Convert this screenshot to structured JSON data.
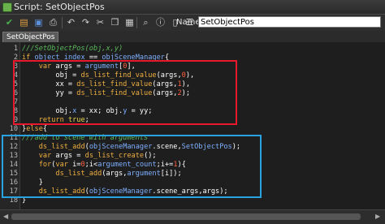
{
  "window": {
    "title": "Script: SetObjectPos"
  },
  "toolbar": {
    "name_label": "Name:",
    "name_value": "SetObjectPos",
    "buttons": [
      {
        "icon": "check-icon",
        "glyph": "✔",
        "color": "#4caf50"
      },
      {
        "icon": "open-icon",
        "glyph": "▤",
        "color": "#e0a040"
      },
      {
        "icon": "save-icon",
        "glyph": "▣",
        "color": "#5b8fd9"
      },
      {
        "icon": "print-icon",
        "glyph": "⎙",
        "color": "#cfcfcf"
      },
      {
        "icon": "undo-icon",
        "glyph": "↶",
        "color": "#cfcfcf"
      },
      {
        "icon": "redo-icon",
        "glyph": "↷",
        "color": "#cfcfcf"
      },
      {
        "icon": "cut-icon",
        "glyph": "✂",
        "color": "#cfcfcf"
      },
      {
        "icon": "copy-icon",
        "glyph": "❐",
        "color": "#cfcfcf"
      },
      {
        "icon": "paste-icon",
        "glyph": "▦",
        "color": "#cfcfcf"
      },
      {
        "icon": "find-icon",
        "glyph": "⌕",
        "color": "#cfcfcf"
      },
      {
        "icon": "info-icon",
        "glyph": "ⓘ",
        "color": "#cfcfcf"
      },
      {
        "icon": "doc-icon",
        "glyph": "▯",
        "color": "#cfcfcf"
      },
      {
        "icon": "settings-icon",
        "glyph": "☰",
        "color": "#cfcfcf"
      }
    ]
  },
  "tabs": [
    {
      "label": "SetObjectPos"
    }
  ],
  "editor": {
    "lines": [
      {
        "num": "1",
        "html": "<span class='c'>///SetObjectPos(obj,x,y)</span>"
      },
      {
        "num": "2",
        "html": "<span class='k'>if</span> <span class='v'>object_index</span> == <span class='v'>objSceneManager</span>{"
      },
      {
        "num": "3",
        "html": "    <span class='k'>var</span> args = <span class='v'>argument</span>[<span class='n'>0</span>],"
      },
      {
        "num": "4",
        "html": "        obj = <span class='f'>ds_list_find_value</span>(args,<span class='n'>0</span>),"
      },
      {
        "num": "5",
        "html": "        xx = <span class='f'>ds_list_find_value</span>(args,<span class='n'>1</span>),"
      },
      {
        "num": "6",
        "html": "        yy = <span class='f'>ds_list_find_value</span>(args,<span class='n'>2</span>);"
      },
      {
        "num": "7",
        "html": ""
      },
      {
        "num": "8",
        "html": "        obj.<span class='v'>x</span> = xx; obj.<span class='v'>y</span> = yy;"
      },
      {
        "num": "9",
        "html": "    <span class='k'>return</span> <span class='s'>true</span>;"
      },
      {
        "num": "10",
        "html": "}<span class='k'>else</span>{"
      },
      {
        "num": "11",
        "html": "<span class='c'>///add to scene with arguments</span>"
      },
      {
        "num": "12",
        "html": "    <span class='f'>ds_list_add</span>(<span class='v'>objSceneManager</span>.scene,<span class='v'>SetObjectPos</span>);"
      },
      {
        "num": "13",
        "html": "    <span class='k'>var</span> args = <span class='f'>ds_list_create</span>();"
      },
      {
        "num": "14",
        "html": "    <span class='k'>for</span>(<span class='k'>var</span> i=<span class='n'>0</span>;i&lt;<span class='v'>argument_count</span>;i+=<span class='n'>1</span>){"
      },
      {
        "num": "15",
        "html": "        <span class='f'>ds_list_add</span>(args,<span class='v'>argument</span>[i]);"
      },
      {
        "num": "16",
        "html": "    }"
      },
      {
        "num": "17",
        "html": "    <span class='f'>ds_list_add</span>(<span class='v'>objSceneManager</span>.scene_args,args);"
      },
      {
        "num": "18",
        "html": "}"
      }
    ]
  }
}
